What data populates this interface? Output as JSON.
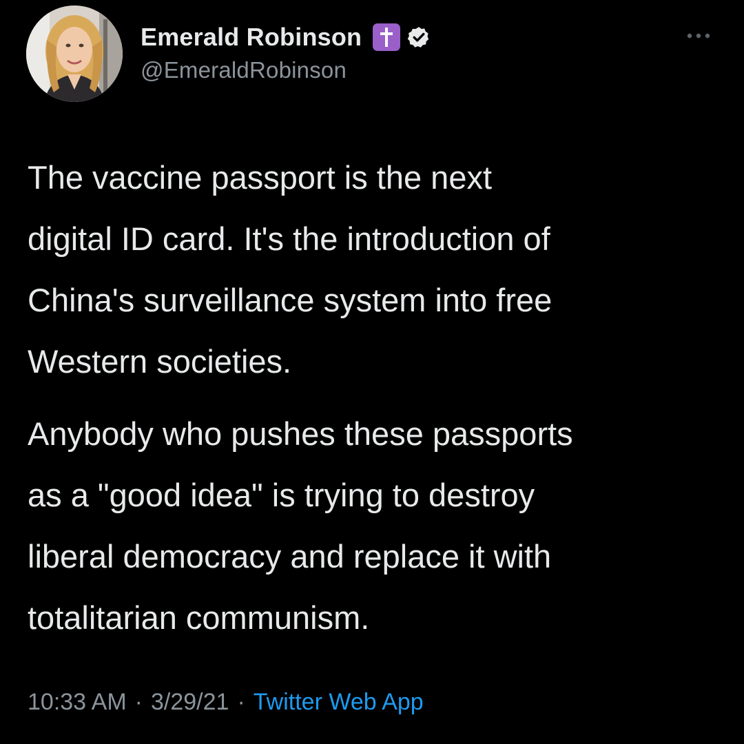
{
  "author": {
    "display_name": "Emerald Robinson",
    "handle": "@EmeraldRobinson",
    "badge_icons": [
      "latin-cross-icon",
      "verified-icon"
    ]
  },
  "tweet": {
    "paragraphs": [
      {
        "lines": [
          "The vaccine passport is the next",
          "digital ID card. It's the introduction of",
          "China's surveillance system into free",
          "Western societies."
        ]
      },
      {
        "lines": [
          "Anybody who pushes these passports",
          "as a \"good idea\" is trying to destroy",
          "liberal democracy and replace it with",
          "totalitarian communism."
        ]
      }
    ]
  },
  "meta": {
    "time": "10:33 AM",
    "separator": "·",
    "date": "3/29/21",
    "source": "Twitter Web App"
  },
  "colors": {
    "background": "#000000",
    "text": "#e7e9ea",
    "secondary": "#8b949b",
    "link": "#1d9bf0",
    "cross_badge": "#9b5fc9"
  }
}
